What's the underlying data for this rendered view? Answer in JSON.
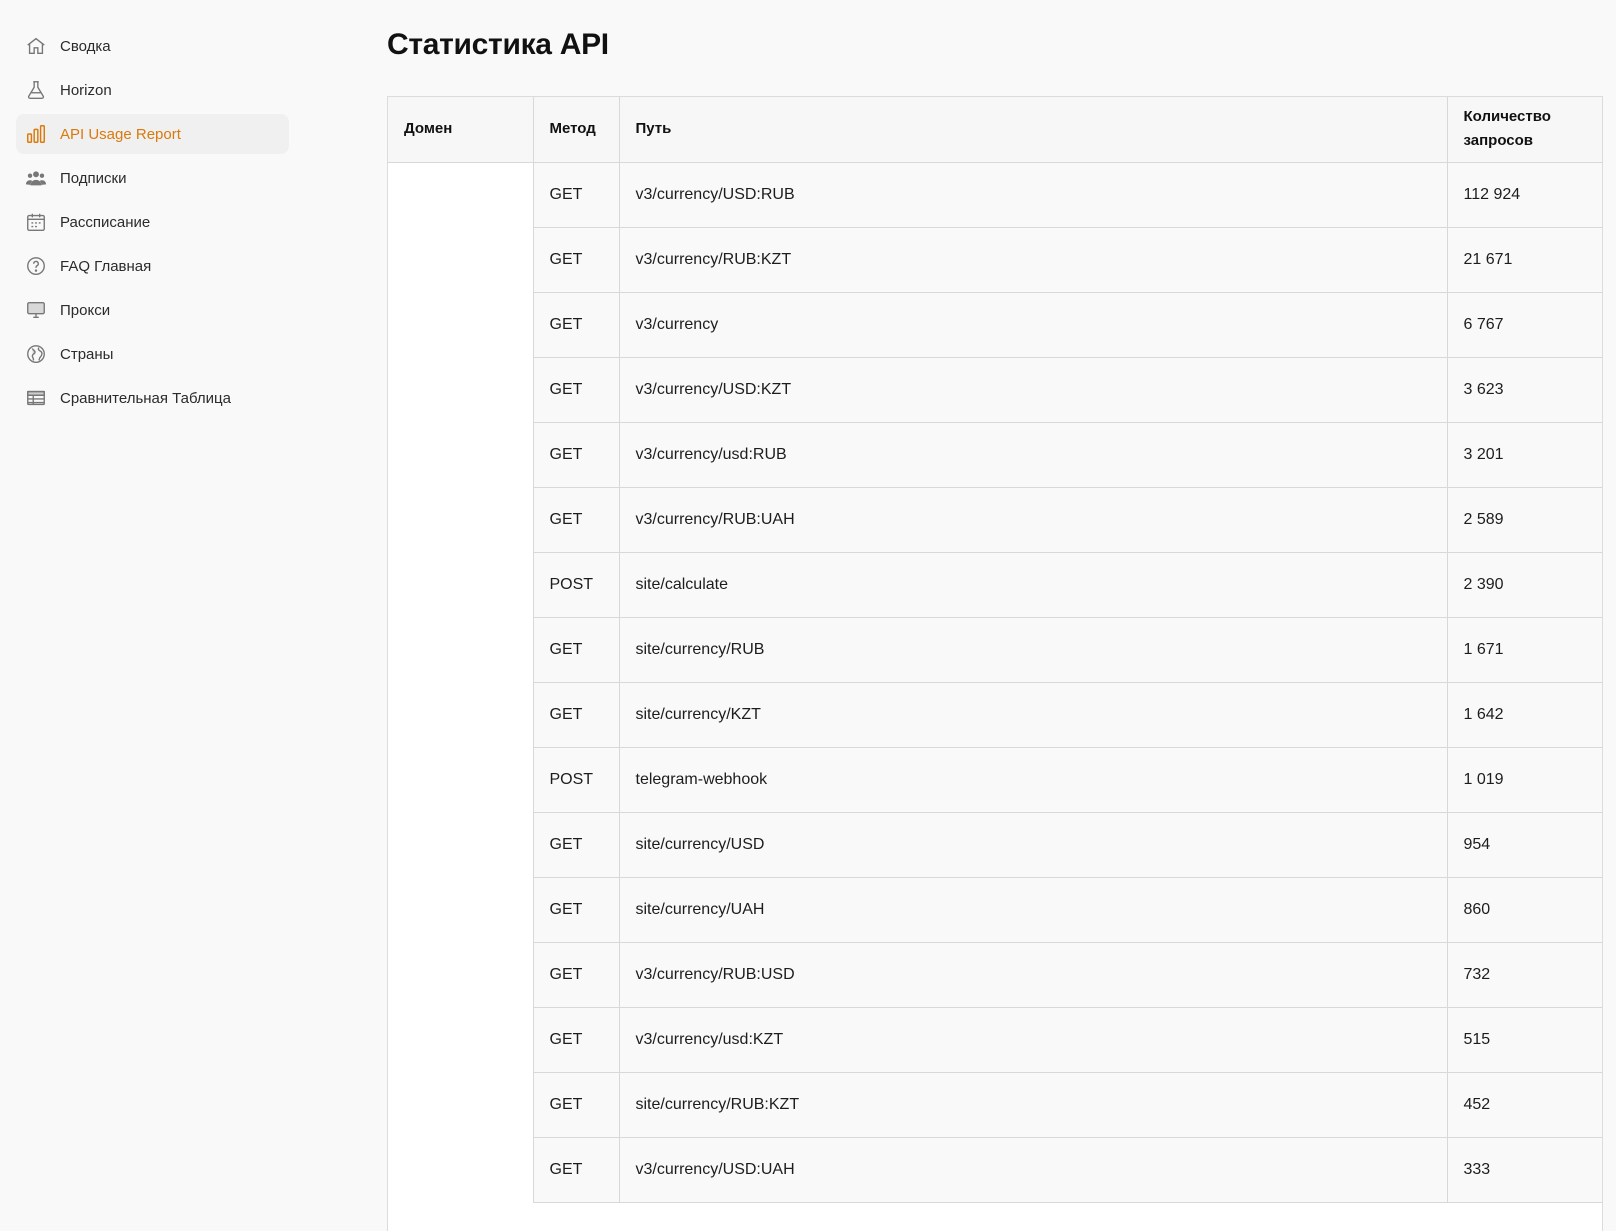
{
  "sidebar": {
    "items": [
      {
        "label": "Сводка",
        "icon": "home-icon",
        "active": false
      },
      {
        "label": "Horizon",
        "icon": "flask-icon",
        "active": false
      },
      {
        "label": "API Usage Report",
        "icon": "bar-chart-icon",
        "active": true
      },
      {
        "label": "Подписки",
        "icon": "users-icon",
        "active": false
      },
      {
        "label": "Рассписание",
        "icon": "calendar-icon",
        "active": false
      },
      {
        "label": "FAQ Главная",
        "icon": "question-circle-icon",
        "active": false
      },
      {
        "label": "Прокси",
        "icon": "monitor-icon",
        "active": false
      },
      {
        "label": "Страны",
        "icon": "globe-icon",
        "active": false
      },
      {
        "label": "Сравнительная Таблица",
        "icon": "table-icon",
        "active": false
      }
    ]
  },
  "page": {
    "title": "Статистика API"
  },
  "table": {
    "headers": {
      "domain": "Домен",
      "method": "Метод",
      "path": "Путь",
      "count": "Количество запросов"
    },
    "rows": [
      {
        "method": "GET",
        "path": "v3/currency/USD:RUB",
        "count": "112 924"
      },
      {
        "method": "GET",
        "path": "v3/currency/RUB:KZT",
        "count": "21 671"
      },
      {
        "method": "GET",
        "path": "v3/currency",
        "count": "6 767"
      },
      {
        "method": "GET",
        "path": "v3/currency/USD:KZT",
        "count": "3 623"
      },
      {
        "method": "GET",
        "path": "v3/currency/usd:RUB",
        "count": "3 201"
      },
      {
        "method": "GET",
        "path": "v3/currency/RUB:UAH",
        "count": "2 589"
      },
      {
        "method": "POST",
        "path": "site/calculate",
        "count": "2 390"
      },
      {
        "method": "GET",
        "path": "site/currency/RUB",
        "count": "1 671"
      },
      {
        "method": "GET",
        "path": "site/currency/KZT",
        "count": "1 642"
      },
      {
        "method": "POST",
        "path": "telegram-webhook",
        "count": "1 019"
      },
      {
        "method": "GET",
        "path": "site/currency/USD",
        "count": "954"
      },
      {
        "method": "GET",
        "path": "site/currency/UAH",
        "count": "860"
      },
      {
        "method": "GET",
        "path": "v3/currency/RUB:USD",
        "count": "732"
      },
      {
        "method": "GET",
        "path": "v3/currency/usd:KZT",
        "count": "515"
      },
      {
        "method": "GET",
        "path": "site/currency/RUB:KZT",
        "count": "452"
      },
      {
        "method": "GET",
        "path": "v3/currency/USD:UAH",
        "count": "333"
      }
    ]
  },
  "colors": {
    "accent": "#d97a0c",
    "active_bg": "#f0f0f0",
    "border": "#d8d8d8"
  }
}
